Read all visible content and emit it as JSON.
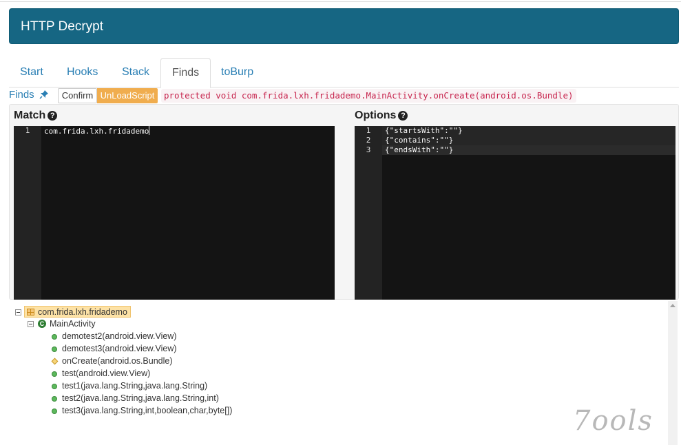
{
  "app": {
    "title": "HTTP Decrypt"
  },
  "tabs": [
    {
      "label": "Start",
      "active": false
    },
    {
      "label": "Hooks",
      "active": false
    },
    {
      "label": "Stack",
      "active": false
    },
    {
      "label": "Finds",
      "active": true
    },
    {
      "label": "toBurp",
      "active": false
    }
  ],
  "finds_bar": {
    "label": "Finds",
    "pin_icon": "pin-icon",
    "confirm_label": "Confirm",
    "unload_label": "UnLoadScript",
    "method_signature": "protected void com.frida.lxh.fridademo.MainActivity.onCreate(android.os.Bundle)"
  },
  "match_panel": {
    "title": "Match",
    "help_icon": "question-circle-icon",
    "lines": [
      {
        "no": "1",
        "text": "com.frida.lxh.fridademo"
      }
    ]
  },
  "options_panel": {
    "title": "Options",
    "help_icon": "question-circle-icon",
    "lines": [
      {
        "no": "1",
        "text": "{\"startsWith\":\"\"}"
      },
      {
        "no": "2",
        "text": "{\"contains\":\"\"}"
      },
      {
        "no": "3",
        "text": "{\"endsWith\":\"\"}"
      }
    ]
  },
  "tree": {
    "package": {
      "label": "com.frida.lxh.fridademo",
      "icon": "package-icon"
    },
    "class": {
      "label": "MainActivity",
      "icon": "class-icon"
    },
    "methods": [
      {
        "label": "demotest2(android.view.View)",
        "icon": "public-method-icon"
      },
      {
        "label": "demotest3(android.view.View)",
        "icon": "public-method-icon"
      },
      {
        "label": "onCreate(android.os.Bundle)",
        "icon": "protected-method-icon"
      },
      {
        "label": "test(android.view.View)",
        "icon": "public-method-icon"
      },
      {
        "label": "test1(java.lang.String,java.lang.String)",
        "icon": "public-method-icon"
      },
      {
        "label": "test2(java.lang.String,java.lang.String,int)",
        "icon": "public-method-icon"
      },
      {
        "label": "test3(java.lang.String,int,boolean,char,byte[])",
        "icon": "public-method-icon"
      }
    ]
  },
  "watermark": {
    "text": "7ools"
  },
  "colors": {
    "header": "#166683",
    "link": "#2a7fb4",
    "unload": "#f0ad4e",
    "code": "#c7254e",
    "editor_bg": "#141414"
  }
}
